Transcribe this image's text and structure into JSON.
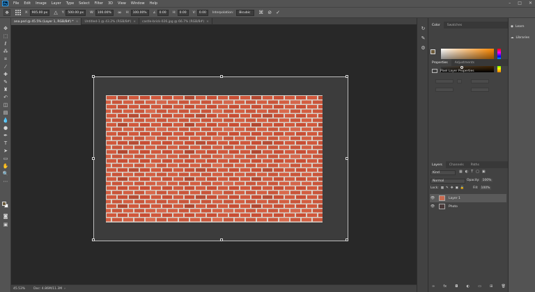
{
  "menu": [
    "File",
    "Edit",
    "Image",
    "Layer",
    "Type",
    "Select",
    "Filter",
    "3D",
    "View",
    "Window",
    "Help"
  ],
  "app_logo": "Ps",
  "window_controls": [
    "–",
    "□",
    "✕"
  ],
  "options_bar": {
    "x_label": "X:",
    "x_value": "905.00 px",
    "y_label": "Y:",
    "y_value": "500.00 px",
    "w_label": "W:",
    "w_value": "100.00%",
    "h_label": "H:",
    "h_value": "100.00%",
    "angle_label": "∠",
    "angle_value": "0.00",
    "hskew_label": "H:",
    "hskew_value": "0.00",
    "vskew_label": "V:",
    "vskew_value": "0.00",
    "interp_label": "Interpolation:",
    "interp_value": "Bicubic"
  },
  "tabs": [
    {
      "title": "ana.psd @ 45.5% (Layer 1, RGB/8#) *"
    },
    {
      "title": "Untitled-1 @ 43.2% (RGB/8#)"
    },
    {
      "title": "castle-brick-026.jpg @ 66.7% (RGB/8#)"
    }
  ],
  "status": {
    "zoom": "45.53%",
    "doc": "Doc: 4.86M/11.3M"
  },
  "color_panel": {
    "tabs": [
      "Color",
      "Swatches"
    ],
    "fg": "#6b5a3a",
    "hue": "#ff8a00"
  },
  "properties": {
    "tabs": [
      "Properties",
      "Adjustments"
    ],
    "title": "Pixel Layer Properties"
  },
  "layers_panel": {
    "tabs": [
      "Layers",
      "Channels",
      "Paths"
    ],
    "filter": "Kind",
    "blend_mode": "Normal",
    "opacity_label": "Opacity:",
    "opacity_value": "100%",
    "lock_label": "Lock:",
    "fill_label": "Fill:",
    "fill_value": "100%",
    "layers": [
      {
        "name": "Layer 1",
        "selected": true
      },
      {
        "name": "Photo",
        "selected": false
      }
    ]
  },
  "libraries": {
    "items": [
      "Learn",
      "Libraries"
    ]
  }
}
